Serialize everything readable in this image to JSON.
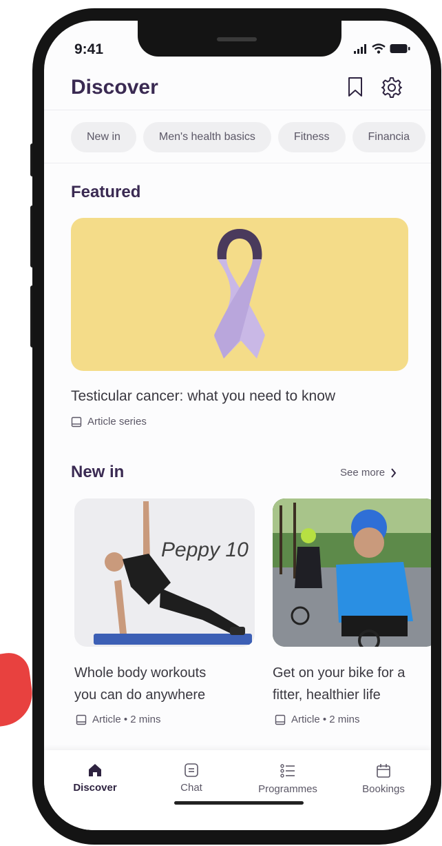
{
  "status_bar": {
    "time": "9:41"
  },
  "header": {
    "title": "Discover",
    "bookmark_icon": "bookmark-icon",
    "settings_icon": "gear-icon"
  },
  "chips": [
    "New in",
    "Men's health basics",
    "Fitness",
    "Financia"
  ],
  "featured": {
    "title": "Featured",
    "card_title": "Testicular cancer: what you need to know",
    "meta": "Article series",
    "colors": {
      "card_bg": "#f4dc89",
      "ribbon": "#c9b8e6",
      "ribbon_top": "#4a3a5c"
    }
  },
  "new_in": {
    "title": "New in",
    "see_more": "See more",
    "cards": [
      {
        "title_line1": "Whole body workouts",
        "title_line2": "you can do anywhere",
        "meta": "Article • 2 mins",
        "image_text": "Peppy 10"
      },
      {
        "title_line1": "Get on your bike for a",
        "title_line2": "fitter, healthier life",
        "meta": "Article • 2 mins"
      }
    ]
  },
  "tabs": [
    {
      "label": "Discover",
      "icon": "home-icon",
      "active": true
    },
    {
      "label": "Chat",
      "icon": "chat-icon",
      "active": false
    },
    {
      "label": "Programmes",
      "icon": "list-icon",
      "active": false
    },
    {
      "label": "Bookings",
      "icon": "calendar-icon",
      "active": false
    }
  ],
  "colors": {
    "accent": "#3a2a52",
    "text": "#3a3840",
    "muted": "#5b5766",
    "chip_bg": "#efeff1",
    "frame": "#141414"
  }
}
